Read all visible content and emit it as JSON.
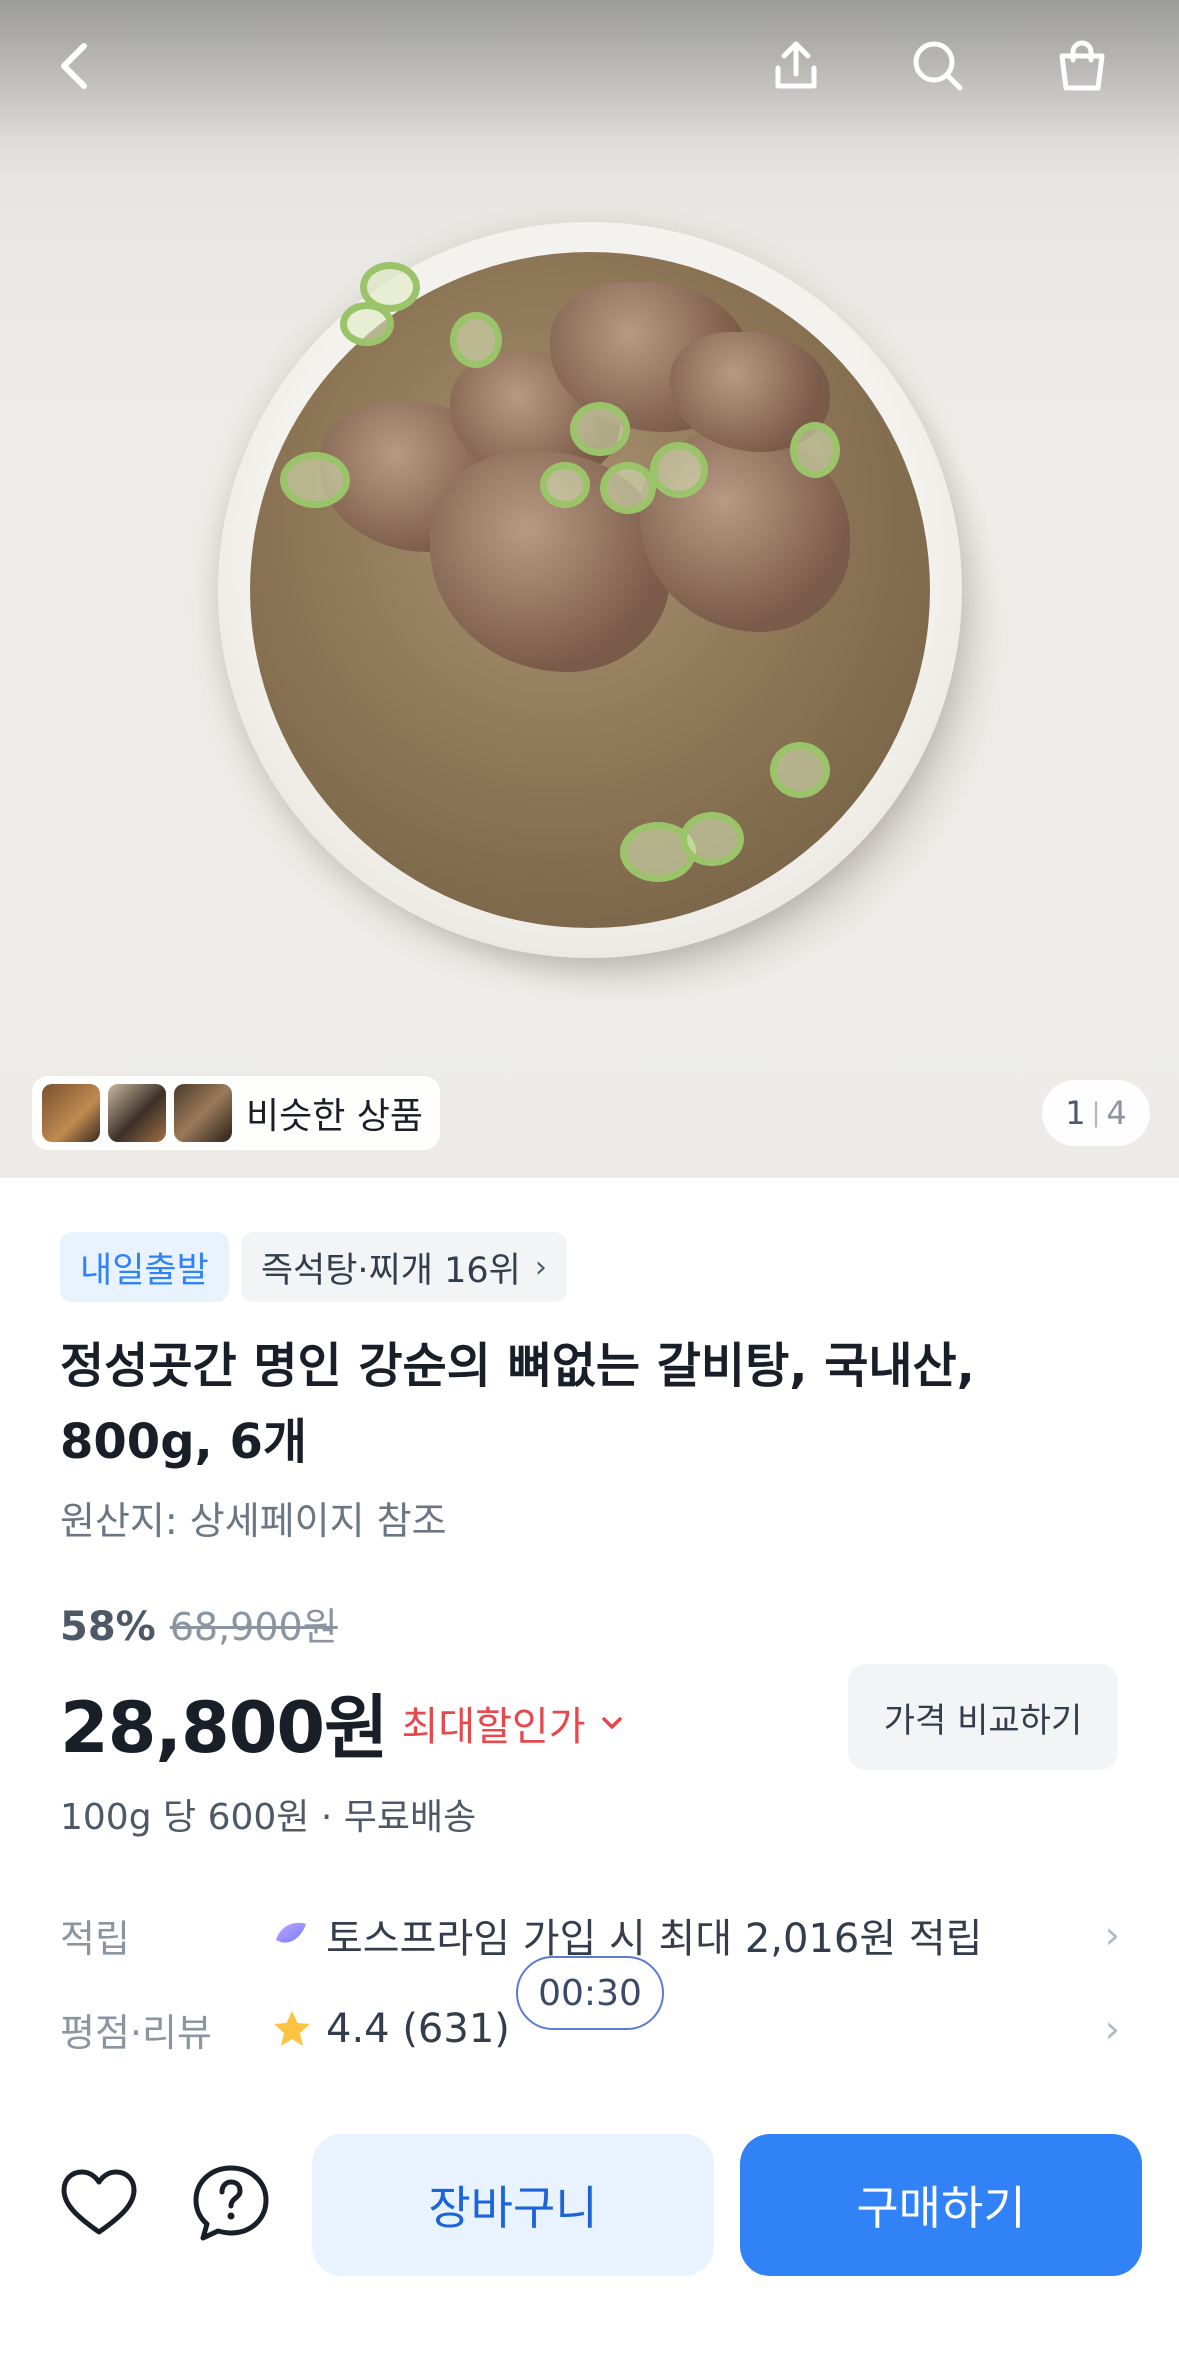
{
  "header": {
    "back_icon": "chevron-left-icon",
    "share_icon": "share-icon",
    "search_icon": "search-icon",
    "cart_icon": "shopping-bag-icon"
  },
  "gallery": {
    "similar_label": "비슷한 상품",
    "current": "1",
    "total": "4"
  },
  "badges": {
    "delivery": "내일출발",
    "ranking": "즉석탕·찌개 16위"
  },
  "product": {
    "title": "정성곳간 명인 강순의 뼈없는 갈비탕, 국내산, 800g, 6개",
    "origin": "원산지: 상세페이지 참조",
    "discount_rate": "58%",
    "original_price": "68,900원",
    "price": "28,800원",
    "max_discount_label": "최대할인가",
    "compare_button": "가격 비교하기",
    "unit_shipping": "100g 당 600원 · 무료배송"
  },
  "points": {
    "label": "적립",
    "value": "토스프라임 가입 시 최대 2,016원 적립"
  },
  "rating": {
    "label": "평점·리뷰",
    "value": "4.4 (631)"
  },
  "timer": "00:30",
  "actions": {
    "cart_label": "장바구니",
    "buy_label": "구매하기"
  },
  "colors": {
    "accent": "#3182f6",
    "discount_red": "#e5484d",
    "star": "#ffc342"
  }
}
